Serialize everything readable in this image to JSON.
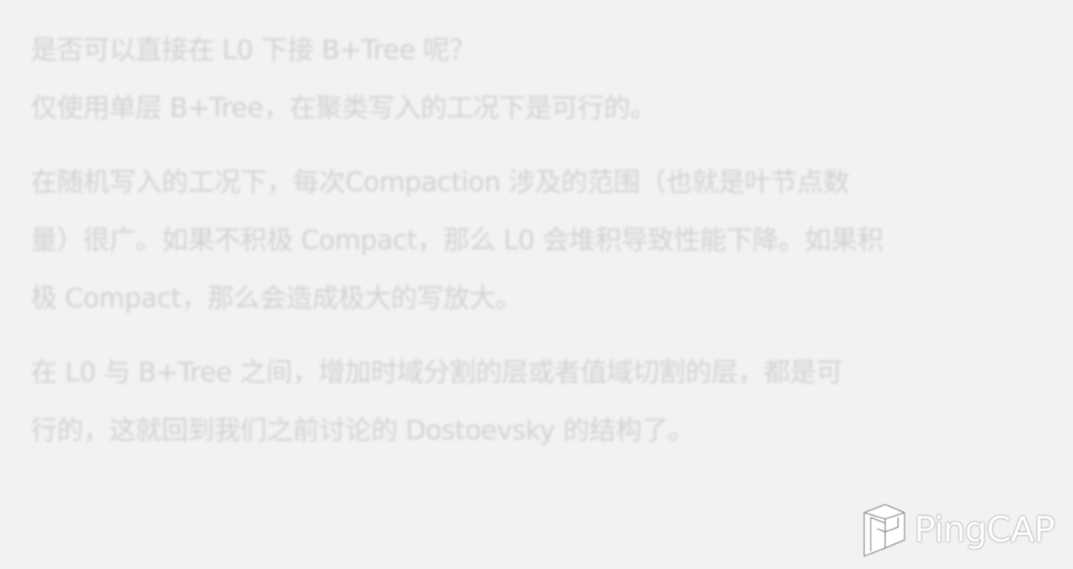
{
  "slide": {
    "paragraphs": [
      {
        "lines": [
          "是否可以直接在 L0 下接 B+Tree 呢？",
          "仅使用单层 B+Tree，在聚类写入的工况下是可行的。"
        ]
      },
      {
        "lines": [
          "在随机写入的工况下，每次Compaction 涉及的范围（也就是叶节点数",
          "量）很广。如果不积极 Compact，那么 L0 会堆积导致性能下降。如果积",
          "极 Compact，那么会造成极大的写放大。"
        ]
      },
      {
        "lines": [
          "在 L0 与 B+Tree 之间，增加时域分割的层或者值域切割的层，都是可",
          "行的，这就回到我们之前讨论的 Dostoevsky 的结构了。"
        ]
      }
    ]
  },
  "logo": {
    "text": "PingCAP",
    "icon": "pingcap-logo-icon"
  },
  "colors": {
    "background": "#f2f2f2",
    "text": "#d2d2d2",
    "logo": "#ffffff"
  }
}
